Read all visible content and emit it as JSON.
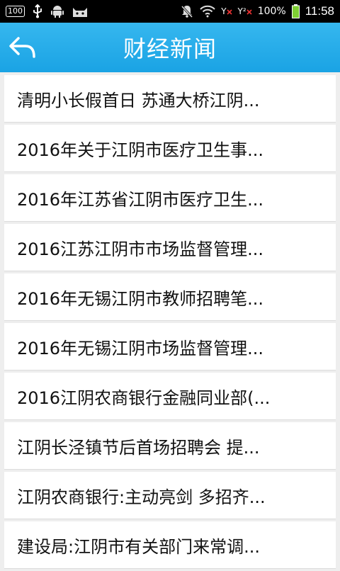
{
  "status_bar": {
    "badge": "100",
    "battery_percent": "100%",
    "time": "11:58",
    "signal_1_label": "Y",
    "signal_2_label": "Y²"
  },
  "header": {
    "title": "财经新闻",
    "accent_color": "#23abea"
  },
  "news": {
    "items": [
      "清明小长假首日 苏通大桥江阴...",
      "2016年关于江阴市医疗卫生事...",
      "2016年江苏省江阴市医疗卫生...",
      "2016江苏江阴市市场监督管理...",
      "2016年无锡江阴市教师招聘笔...",
      "2016年无锡江阴市场监督管理...",
      "2016江阴农商银行金融同业部(...",
      "江阴长泾镇节后首场招聘会 提...",
      "江阴农商银行:主动亮剑 多招齐...",
      "建设局:江阴市有关部门来常调..."
    ]
  }
}
